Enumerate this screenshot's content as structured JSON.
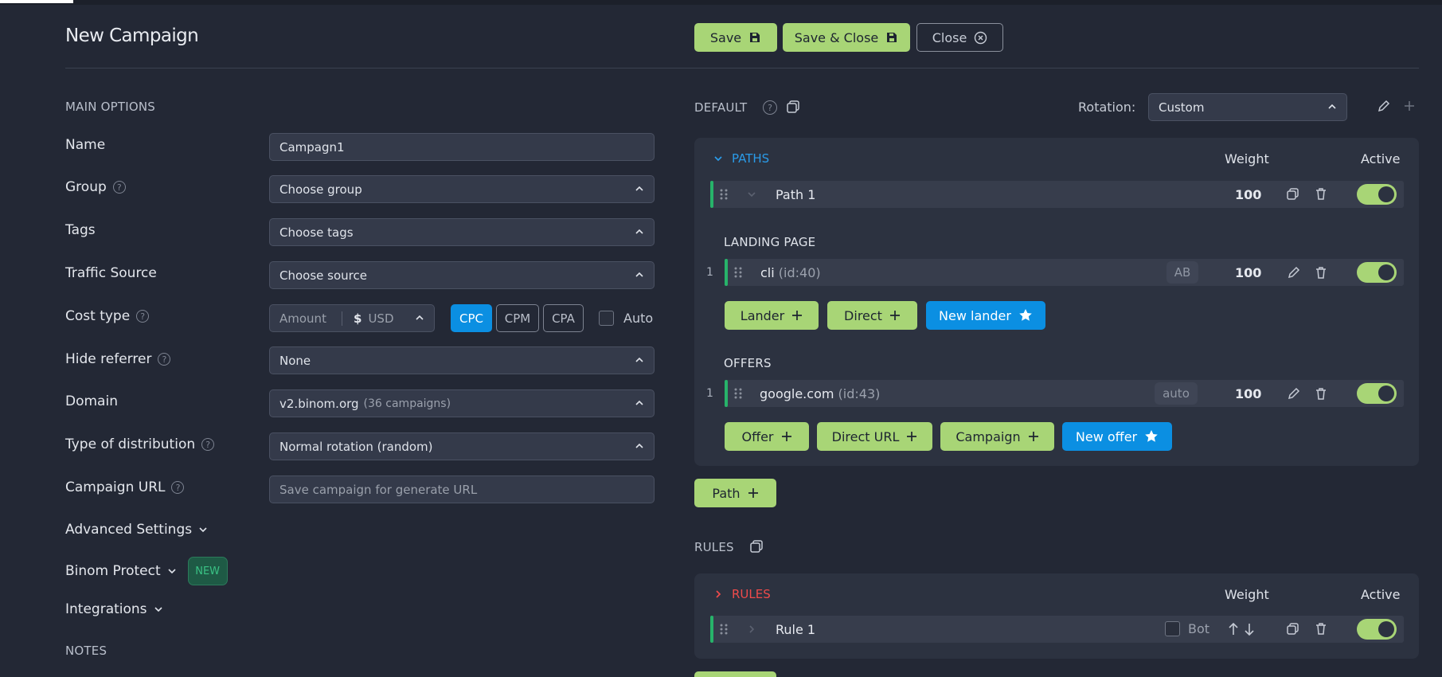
{
  "header": {
    "title": "New Campaign",
    "save_label": "Save",
    "save_close_label": "Save & Close",
    "close_label": "Close"
  },
  "main_options": {
    "section_title": "MAIN OPTIONS",
    "name_label": "Name",
    "name_value": "Campagn1",
    "group_label": "Group",
    "group_value": "Choose group",
    "tags_label": "Tags",
    "tags_value": "Choose tags",
    "traffic_label": "Traffic Source",
    "traffic_value": "Choose source",
    "cost_label": "Cost type",
    "cost_amount_placeholder": "Amount",
    "cost_currency_symbol": "$",
    "cost_currency": "USD",
    "cost_options": [
      "CPC",
      "CPM",
      "CPA"
    ],
    "cost_selected": "CPC",
    "auto_label": "Auto",
    "hide_ref_label": "Hide referrer",
    "hide_ref_value": "None",
    "domain_label": "Domain",
    "domain_value": "v2.binom.org",
    "domain_count": "(36 campaigns)",
    "distribution_label": "Type of distribution",
    "distribution_value": "Normal rotation (random)",
    "url_label": "Campaign URL",
    "url_placeholder": "Save campaign for generate URL",
    "advanced_label": "Advanced Settings",
    "protect_label": "Binom Protect",
    "protect_badge": "NEW",
    "integrations_label": "Integrations",
    "notes_label": "NOTES"
  },
  "default_section": {
    "title": "DEFAULT",
    "rotation_label": "Rotation:",
    "rotation_value": "Custom",
    "paths_title": "PATHS",
    "weight_head": "Weight",
    "active_head": "Active",
    "path_name": "Path 1",
    "path_weight": "100",
    "landing_title": "LANDING PAGE",
    "landing_index": "1",
    "landing_name": "cli",
    "landing_id": "(id:40)",
    "landing_badge": "AB",
    "landing_weight": "100",
    "lander_btn": "Lander",
    "direct_btn": "Direct",
    "new_lander_btn": "New lander",
    "offers_title": "OFFERS",
    "offer_index": "1",
    "offer_name": "google.com",
    "offer_id": "(id:43)",
    "offer_badge": "auto",
    "offer_weight": "100",
    "offer_btn": "Offer",
    "direct_url_btn": "Direct URL",
    "campaign_btn": "Campaign",
    "new_offer_btn": "New offer",
    "path_btn": "Path"
  },
  "rules_section": {
    "title": "RULES",
    "rules_title": "RULES",
    "weight_head": "Weight",
    "active_head": "Active",
    "rule_name": "Rule 1",
    "bot_label": "Bot"
  },
  "colors": {
    "background": "#232835",
    "panel": "#2c3240",
    "accent_green": "#a8d576",
    "accent_blue": "#0b8fe2",
    "path_accent": "#27b36a",
    "rules_red": "#ef4b4b",
    "paths_blue": "#2a9be8"
  },
  "toggles": {
    "path_active": true,
    "landing_active": true,
    "offer_active": true,
    "rule_active": true
  }
}
